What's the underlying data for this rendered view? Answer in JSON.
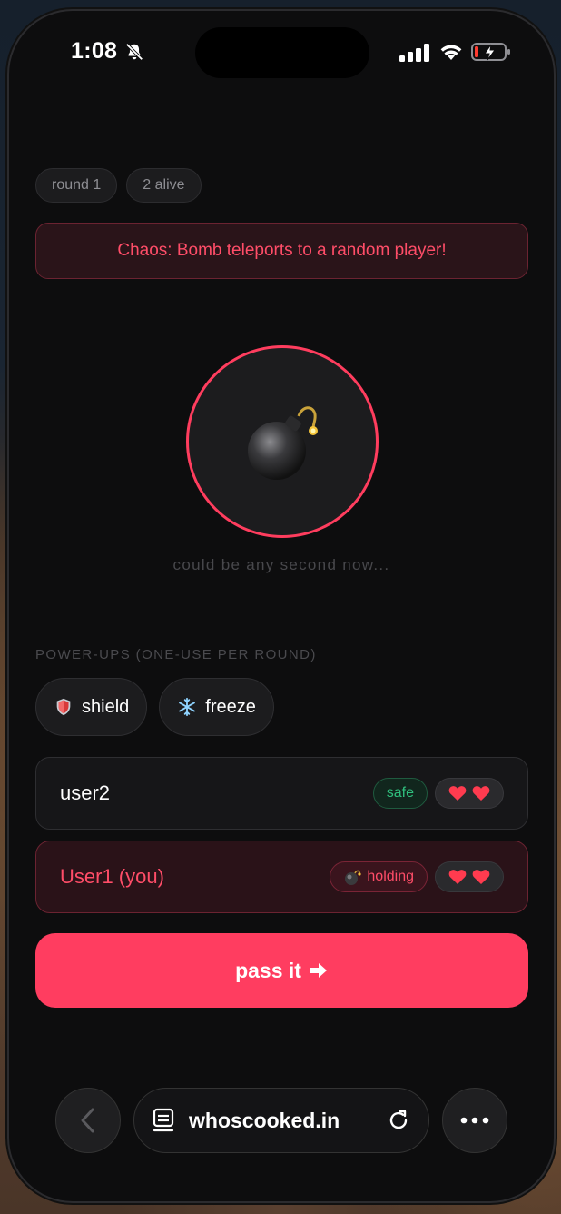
{
  "status_bar": {
    "time": "1:08"
  },
  "game": {
    "chips": {
      "round": "round 1",
      "alive": "2 alive"
    },
    "banner": "Chaos: Bomb teleports to a random player!",
    "subtitle": "could be any second now...",
    "powerups_label": "POWER-UPS (ONE-USE PER ROUND)",
    "powerups": [
      {
        "label": "shield",
        "icon": "shield-icon"
      },
      {
        "label": "freeze",
        "icon": "snowflake-icon"
      }
    ],
    "players": [
      {
        "name": "user2",
        "status": "safe",
        "lives": 2
      },
      {
        "name": "User1 (you)",
        "status": "holding",
        "lives": 2
      }
    ],
    "pass_button": "pass it"
  },
  "browser": {
    "url": "whoscooked.in"
  },
  "colors": {
    "accent": "#ff3d60",
    "safe": "#2fbf7d",
    "background": "#0d0d0e"
  }
}
